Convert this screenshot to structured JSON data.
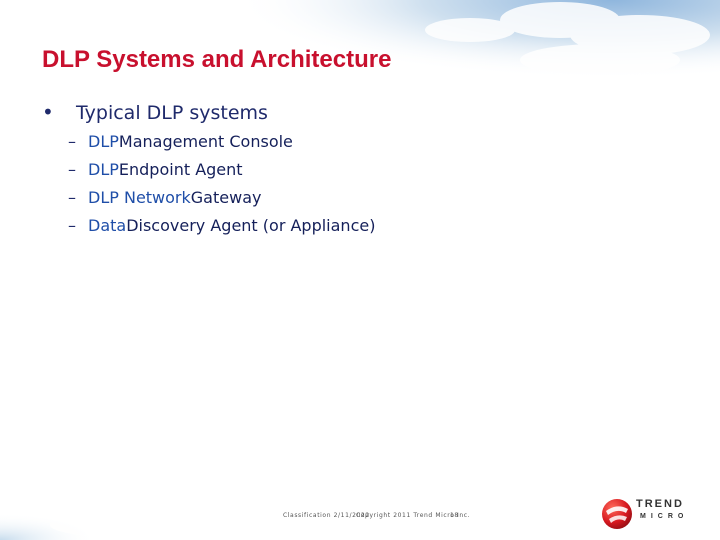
{
  "slide": {
    "title": "DLP Systems and Architecture",
    "bullet": {
      "symbol": "•",
      "text": "Typical DLP systems"
    },
    "sub_items": [
      {
        "dash": "–",
        "light": "DLP ",
        "strong": "Management Console"
      },
      {
        "dash": "–",
        "light": "DLP ",
        "strong": "Endpoint Agent"
      },
      {
        "dash": "–",
        "light": "DLP Network ",
        "strong": "Gateway"
      },
      {
        "dash": "–",
        "light": "Data ",
        "strong": "Discovery Agent (or Appliance)"
      }
    ]
  },
  "footer": {
    "classification": "Classification 2/11/2022",
    "copyright": "Copyright 2011 Trend Micro Inc.",
    "page_number": "18"
  },
  "logo": {
    "line1": "TREND",
    "line2": "MICRO"
  },
  "colors": {
    "title": "#c8102e",
    "body_text": "#1f2a6b",
    "light_text": "#1f4ea8",
    "strong_text": "#15205a",
    "logo_red": "#d71920"
  }
}
